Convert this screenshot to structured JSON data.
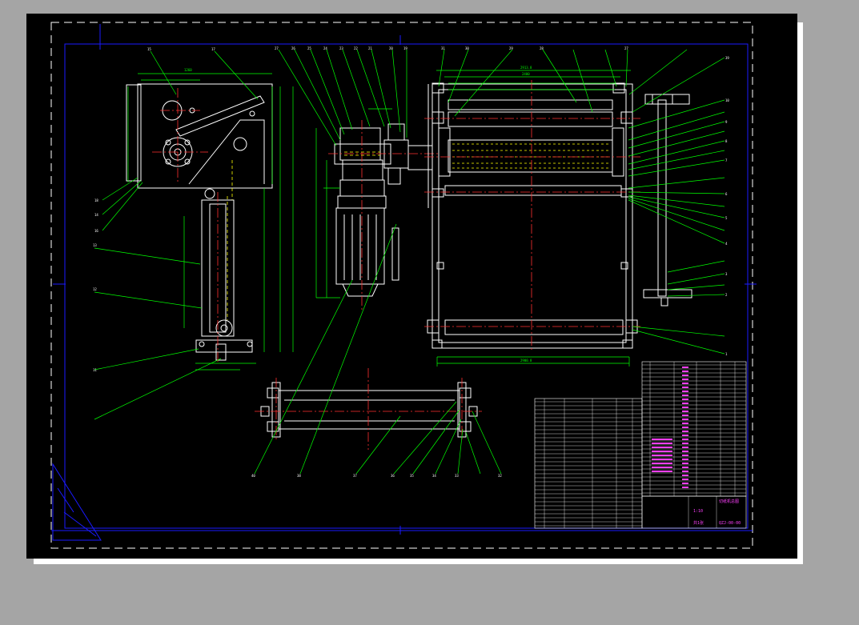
{
  "sheet": {
    "background": "#000000",
    "page_background": "#a5a5a5",
    "frame_color": "#1a1aff",
    "dash_border_color": "#ffffff",
    "leader_color": "#00ff00",
    "outline_color": "#ffffff",
    "center_line_color": "#ff3030",
    "hidden_line_color": "#ffff00",
    "title_text_color": "#ff40ff"
  },
  "balloons": {
    "side_view": [
      "15",
      "17",
      "18",
      "14",
      "16",
      "13",
      "12",
      "11"
    ],
    "center_top": [
      "27",
      "26",
      "25",
      "24",
      "23",
      "22",
      "21",
      "20",
      "19"
    ],
    "right_top": [
      "31",
      "30",
      "29",
      "28",
      "27"
    ],
    "right_column": [
      "39",
      "10",
      "9",
      "8",
      "7",
      "6",
      "5",
      "4",
      "3",
      "2",
      "1"
    ],
    "bottom_roller": [
      "40",
      "38",
      "37",
      "36",
      "35",
      "34",
      "33",
      "32"
    ]
  },
  "dimensions": {
    "top_view_width": "2913.8",
    "top_view_inner": "2400",
    "bottom_width": "2900.8",
    "motor_height": "880",
    "side_height": "1260"
  },
  "title_block": {
    "drawing_name": "切纸机总图",
    "drawing_number": "QZJ-00-00",
    "scale_label": "1:10",
    "sheet_label": "共1张"
  }
}
